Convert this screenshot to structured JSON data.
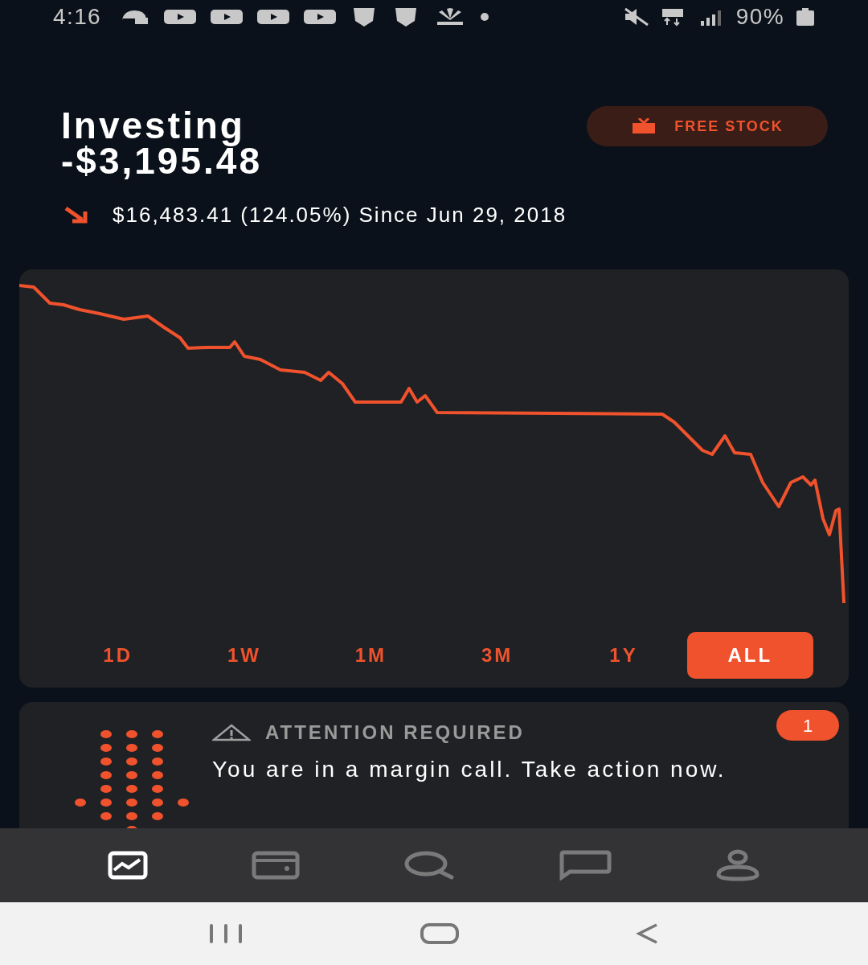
{
  "status_bar": {
    "time": "4:16",
    "battery": "90%"
  },
  "header": {
    "title": "Investing",
    "value": "-$3,195.48",
    "free_stock": "FREE STOCK",
    "change": "$16,483.41 (124.05%) Since Jun 29, 2018"
  },
  "range_tabs": [
    {
      "label": "1D",
      "selected": false
    },
    {
      "label": "1W",
      "selected": false
    },
    {
      "label": "1M",
      "selected": false
    },
    {
      "label": "3M",
      "selected": false
    },
    {
      "label": "1Y",
      "selected": false
    },
    {
      "label": "ALL",
      "selected": true
    }
  ],
  "alert": {
    "heading": "ATTENTION REQUIRED",
    "message": "You are in a margin call. Take action now.",
    "badge": "1"
  },
  "bottom_nav": [
    {
      "kind": "chart",
      "selected": true
    },
    {
      "kind": "wallet",
      "selected": false
    },
    {
      "kind": "search",
      "selected": false
    },
    {
      "kind": "chat",
      "selected": false
    },
    {
      "kind": "account",
      "selected": false
    }
  ]
}
